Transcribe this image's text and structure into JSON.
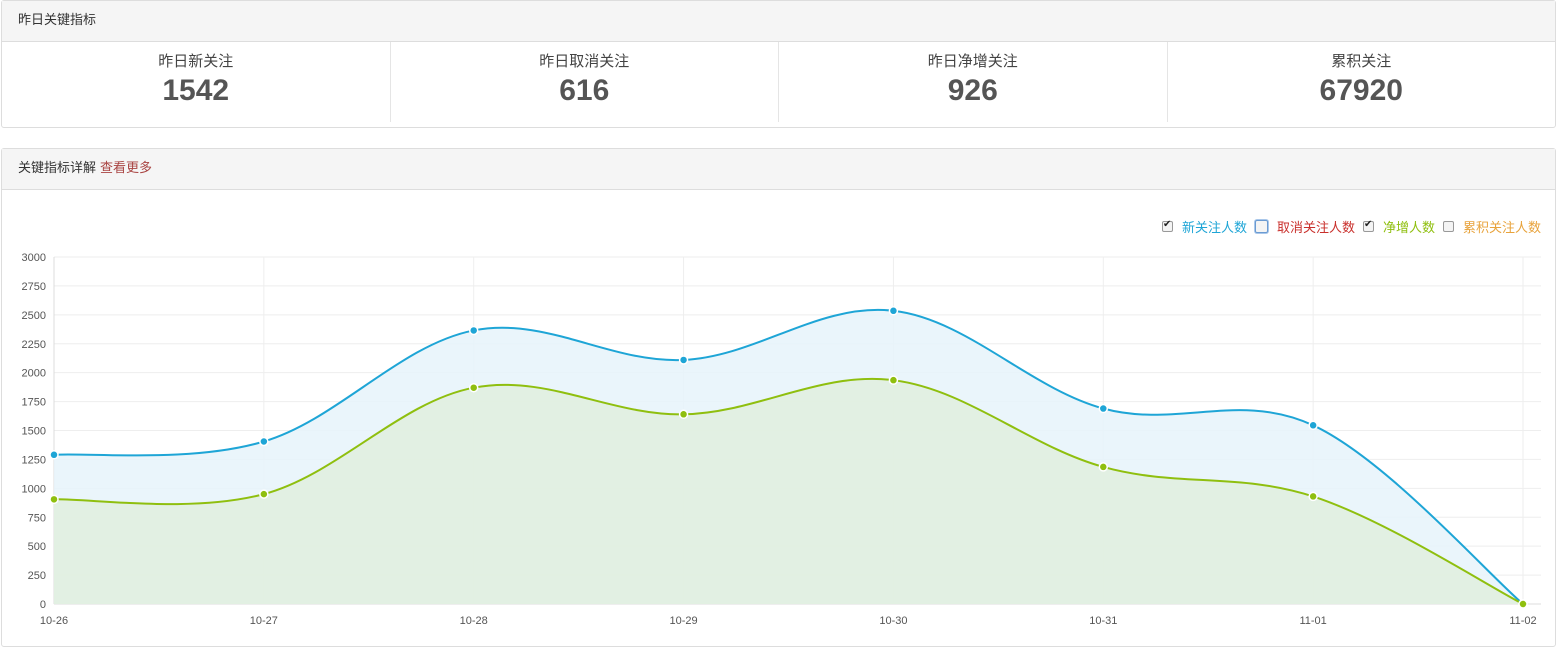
{
  "kpi_panel": {
    "title": "昨日关键指标",
    "items": [
      {
        "label": "昨日新关注",
        "value": "1542"
      },
      {
        "label": "昨日取消关注",
        "value": "616"
      },
      {
        "label": "昨日净增关注",
        "value": "926"
      },
      {
        "label": "累积关注",
        "value": "67920"
      }
    ]
  },
  "detail_panel": {
    "title": "关键指标详解",
    "more_link": "查看更多"
  },
  "legend": [
    {
      "label": "新关注人数",
      "checked": true,
      "color": "#1ea5d6"
    },
    {
      "label": "取消关注人数",
      "checked": false,
      "color": "#c9302c"
    },
    {
      "label": "净增人数",
      "checked": true,
      "color": "#8fbf0f"
    },
    {
      "label": "累积关注人数",
      "checked": false,
      "color": "#e8a33c"
    }
  ],
  "chart_data": {
    "type": "area",
    "categories": [
      "10-26",
      "10-27",
      "10-28",
      "10-29",
      "10-30",
      "10-31",
      "11-01",
      "11-02"
    ],
    "yticks": [
      "0",
      "250",
      "500",
      "750",
      "1000",
      "1250",
      "1500",
      "1750",
      "2000",
      "2250",
      "2500",
      "2750",
      "3000"
    ],
    "ylim": [
      0,
      3000
    ],
    "grid": true,
    "series": [
      {
        "name": "新关注人数",
        "values": [
          1290,
          1405,
          2365,
          2110,
          2535,
          1690,
          1545,
          0
        ],
        "color": "#1ea5d6",
        "fill": "#e6f3fa"
      },
      {
        "name": "净增人数",
        "values": [
          905,
          950,
          1870,
          1640,
          1935,
          1185,
          930,
          0
        ],
        "color": "#8fbf0f",
        "fill": "#e1efde"
      }
    ]
  }
}
